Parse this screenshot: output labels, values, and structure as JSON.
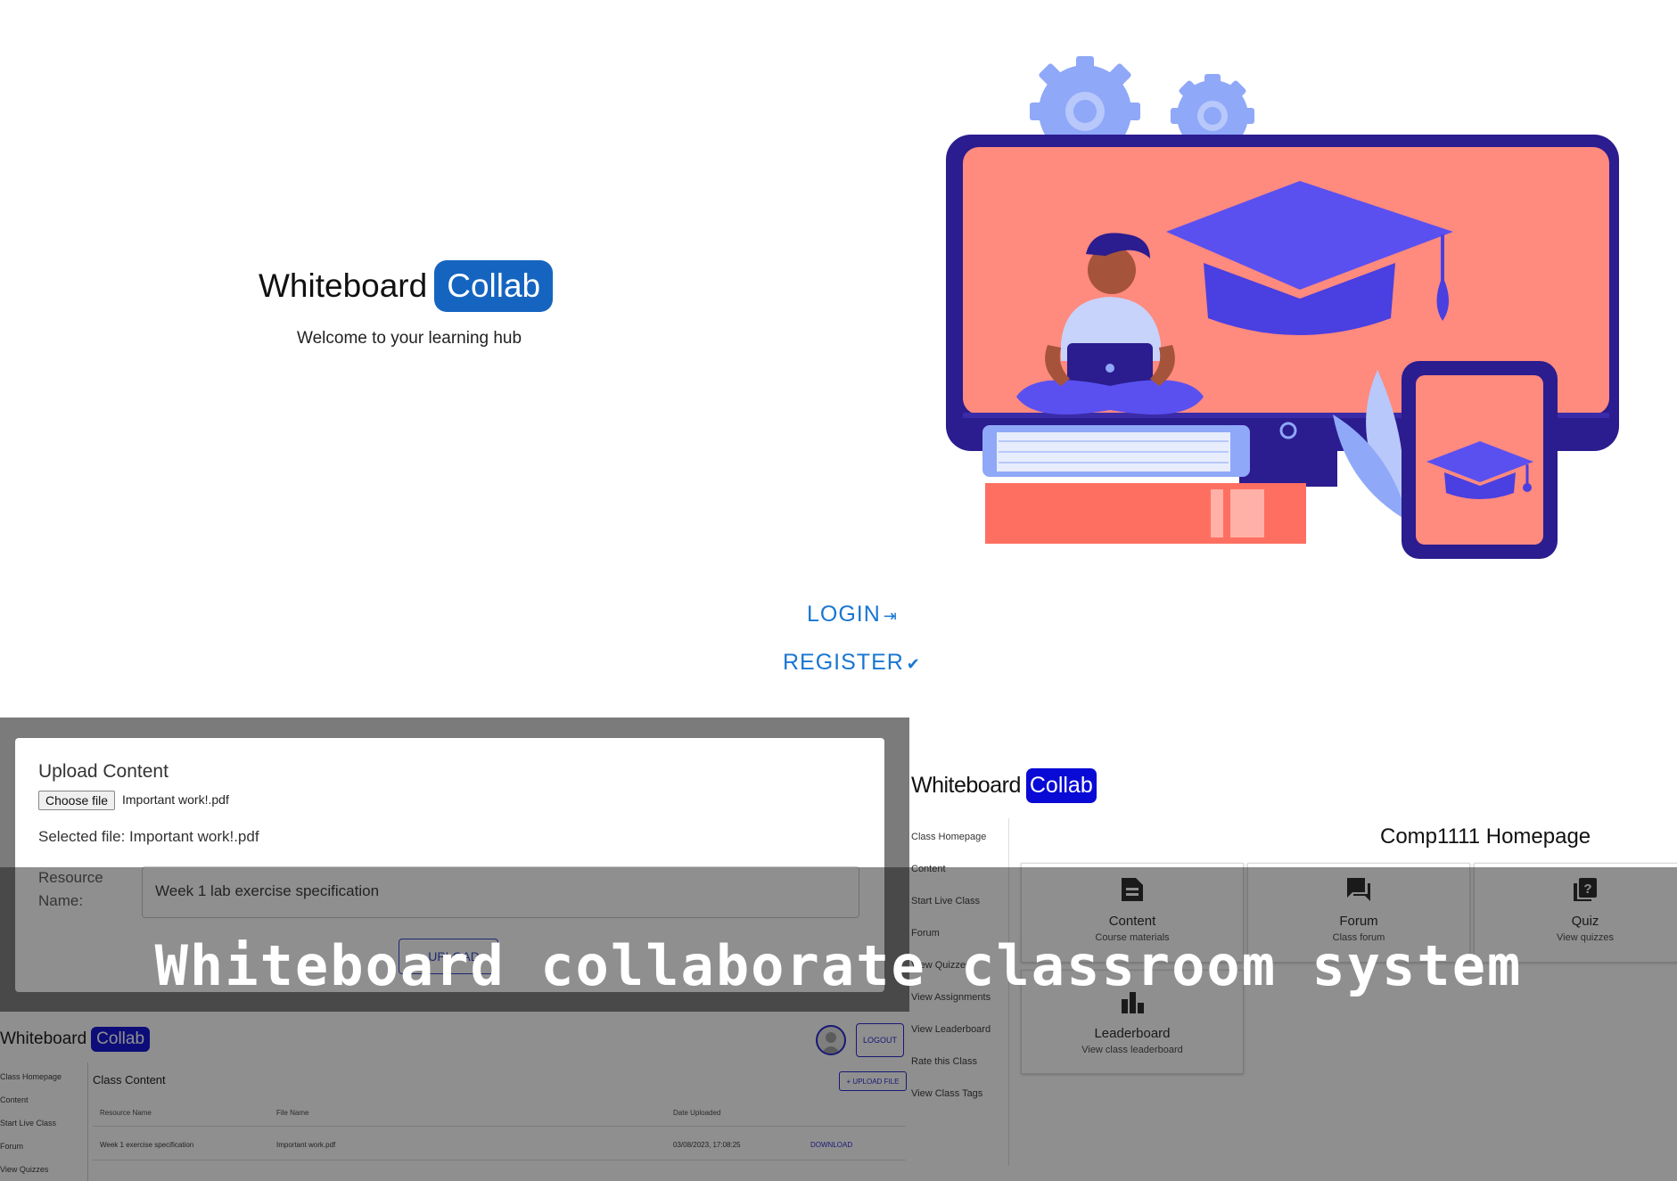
{
  "landing": {
    "brand_word": "Whiteboard",
    "brand_badge": "Collab",
    "tagline": "Welcome to your learning hub",
    "login_label": "LOGIN",
    "register_label": "REGISTER"
  },
  "upload_dialog": {
    "title": "Upload Content",
    "choose_file_label": "Choose file",
    "file_name": "Important work!.pdf",
    "selected_file_text": "Selected file: Important work!.pdf",
    "resource_name_label": "Resource Name:",
    "resource_name_value": "Week 1 lab exercise specification",
    "upload_button_label": "+ UPLOAD"
  },
  "class_content": {
    "brand_word": "Whiteboard",
    "brand_badge": "Collab",
    "logout_label": "LOGOUT",
    "sidebar": [
      "Class Homepage",
      "Content",
      "Start Live Class",
      "Forum",
      "View Quizzes"
    ],
    "title": "Class Content",
    "upload_file_label": "+ UPLOAD FILE",
    "columns": [
      "Resource Name",
      "File Name",
      "Date Uploaded"
    ],
    "rows": [
      {
        "resource": "Week 1 exercise specification",
        "file": "Important work.pdf",
        "date": "03/08/2023, 17:08:25",
        "action": "DOWNLOAD"
      }
    ]
  },
  "class_homepage": {
    "brand_word": "Whiteboard",
    "brand_badge": "Collab",
    "sidebar": [
      "Class Homepage",
      "Content",
      "Start Live Class",
      "Forum",
      "View Quizzes",
      "View Assignments",
      "View Leaderboard",
      "Rate this Class",
      "View Class Tags"
    ],
    "title": "Comp1111 Homepage",
    "cards": [
      {
        "label": "Content",
        "sub": "Course materials",
        "icon": "document-icon"
      },
      {
        "label": "Forum",
        "sub": "Class forum",
        "icon": "forum-icon"
      },
      {
        "label": "Quiz",
        "sub": "View quizzes",
        "icon": "quiz-icon"
      },
      {
        "label": "Leaderboard",
        "sub": "View class leaderboard",
        "icon": "leaderboard-icon"
      }
    ]
  },
  "overlay": {
    "title": "Whiteboard collaborate classroom system"
  },
  "colors": {
    "brand_blue": "#1565c0",
    "badge_blue": "#0a0ad6",
    "link_blue": "#1976d2",
    "illustration_salmon": "#ff8a7e",
    "illustration_navy": "#2b1c8f",
    "illustration_purple": "#5a50f0"
  }
}
